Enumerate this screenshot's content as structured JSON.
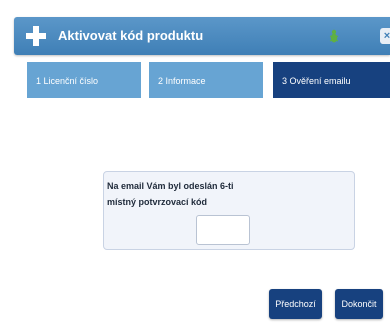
{
  "window": {
    "title": "Aktivovat kód produktu",
    "icon": "plus-icon",
    "close_label": "×"
  },
  "steps": [
    {
      "label": "1 Licenční číslo",
      "active": false
    },
    {
      "label": "2 Informace",
      "active": false
    },
    {
      "label": "3 Ověření emailu",
      "active": true
    }
  ],
  "verification": {
    "message": "Na email Vám byl odeslán 6-ti místný potvrzovací kód",
    "code_value": ""
  },
  "buttons": {
    "previous_label": "Předchozí",
    "finish_label": "Dokončit"
  },
  "colors": {
    "titlebar": "#4a89c0",
    "step_inactive": "#67a4d3",
    "step_active": "#17417f",
    "button": "#17417f"
  }
}
